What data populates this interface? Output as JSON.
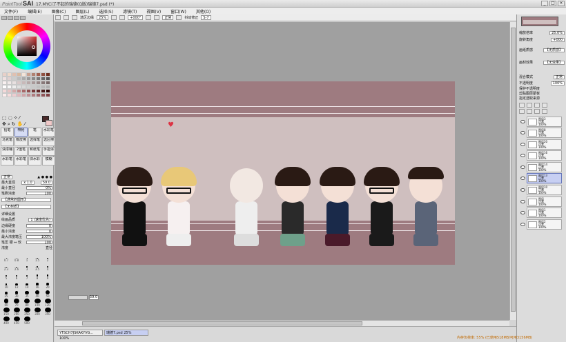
{
  "window": {
    "app_name": "PaintTool",
    "app_short": "SAI",
    "title": "17.MYCi了不起的瑞德(Q版)瑞德7.psd (*)",
    "buttons": [
      "_",
      "□",
      "×"
    ]
  },
  "menu": [
    "文件(F)",
    "编辑(E)",
    "图像(C)",
    "图层(L)",
    "选择(S)",
    "滤镜(T)",
    "视图(V)",
    "窗口(W)",
    "其他(O)"
  ],
  "toolbar": {
    "check_label": "选区边缘",
    "zoom": "25%",
    "angle": "+000°",
    "mode": "正常",
    "stabilizer_label": "抖动修正",
    "stabilizer": "S-7"
  },
  "tools": {
    "brushes": [
      "铅笔",
      "喷枪",
      "笔",
      "水彩笔",
      "马克笔",
      "橡皮擦",
      "选择笔",
      "选区擦",
      "油漆桶",
      "2值笔",
      "和纸笔",
      "手指涂",
      "水彩笔",
      "水彩笔",
      "旧水彩",
      "模糊"
    ],
    "blend_mode": "正常",
    "max_size_label": "最大直径",
    "max_size_mult": "x 1.0",
    "max_size": "59.0",
    "min_size_label": "最小直径",
    "min_size": "0%",
    "density_label": "笔刷浓度",
    "density": "100",
    "shape_1": "【通常的圆形】",
    "shape_2": "【无材质】",
    "detail_label": "详细设置",
    "quality_label": "绘画品质",
    "quality": "1 (速度优先)",
    "edge_label": "边缘硬度",
    "edge": "0",
    "min_density_label": "最小浓度",
    "min_density": "0",
    "max_pressure_label": "最大浓度笔压",
    "max_pressure": "100%",
    "pressure_label": "笔压 硬 ⇔ 软",
    "pressure": "100",
    "pressure_opts": [
      "浓度",
      "直径"
    ]
  },
  "brush_sizes": [
    "0.7",
    "0.8",
    "1",
    "1.5",
    "2",
    "2.3",
    "2.6",
    "3",
    "3.5",
    "4",
    "5",
    "6",
    "7",
    "8",
    "9",
    "10",
    "12",
    "14",
    "16",
    "20",
    "25",
    "30",
    "35",
    "40",
    "50",
    "60",
    "70",
    "80",
    "100",
    "120",
    "150",
    "200",
    "250",
    "300",
    "350",
    "400",
    "450",
    "500"
  ],
  "canvas": {
    "zoom_value": "59.0"
  },
  "doc_tabs": [
    {
      "name": "YTSCH7JSKAKYVG...",
      "zoom": "100%"
    },
    {
      "name": "瑞德7.psd",
      "zoom": "25%"
    }
  ],
  "right_panel": {
    "zoom_label": "缩放倍率",
    "zoom": "25.0%",
    "angle_label": "旋转角度",
    "angle": "+000",
    "paper_label": "画纸质感",
    "paper": "【无质感】",
    "effect_label": "画材效果",
    "effect": "【无效果】",
    "blend_label": "混合模式",
    "blend": "正常",
    "opacity_label": "不透明度",
    "opacity": "100%",
    "checks": [
      "保护不透明度",
      "剪贴图层蒙板",
      "指定选取来源"
    ]
  },
  "layers": [
    {
      "name": "图层3",
      "mode": "正常",
      "opacity": "100%"
    },
    {
      "name": "图层8",
      "mode": "正常",
      "opacity": "100%"
    },
    {
      "name": "图层20",
      "mode": "正常",
      "opacity": "100%"
    },
    {
      "name": "图层16",
      "mode": "正常",
      "opacity": "100%"
    },
    {
      "name": "图层14",
      "mode": "正常",
      "opacity": "100%"
    },
    {
      "name": "图层13",
      "mode": "正常",
      "opacity": "100%"
    },
    {
      "name": "图层10",
      "mode": "正常",
      "opacity": "100%"
    },
    {
      "name": "图层",
      "mode": "正常",
      "opacity": "100%"
    },
    {
      "name": "图层1",
      "mode": "正常",
      "opacity": "100%"
    },
    {
      "name": "图层2",
      "mode": "正常",
      "opacity": "100%"
    }
  ],
  "status": "内存负荷率: 55% (已使用518MB/可用3156MB)",
  "colors": {
    "canvas_frame": "#9e7b80",
    "canvas_inner": "#cfbfbf",
    "selected": "#c7cff2"
  }
}
